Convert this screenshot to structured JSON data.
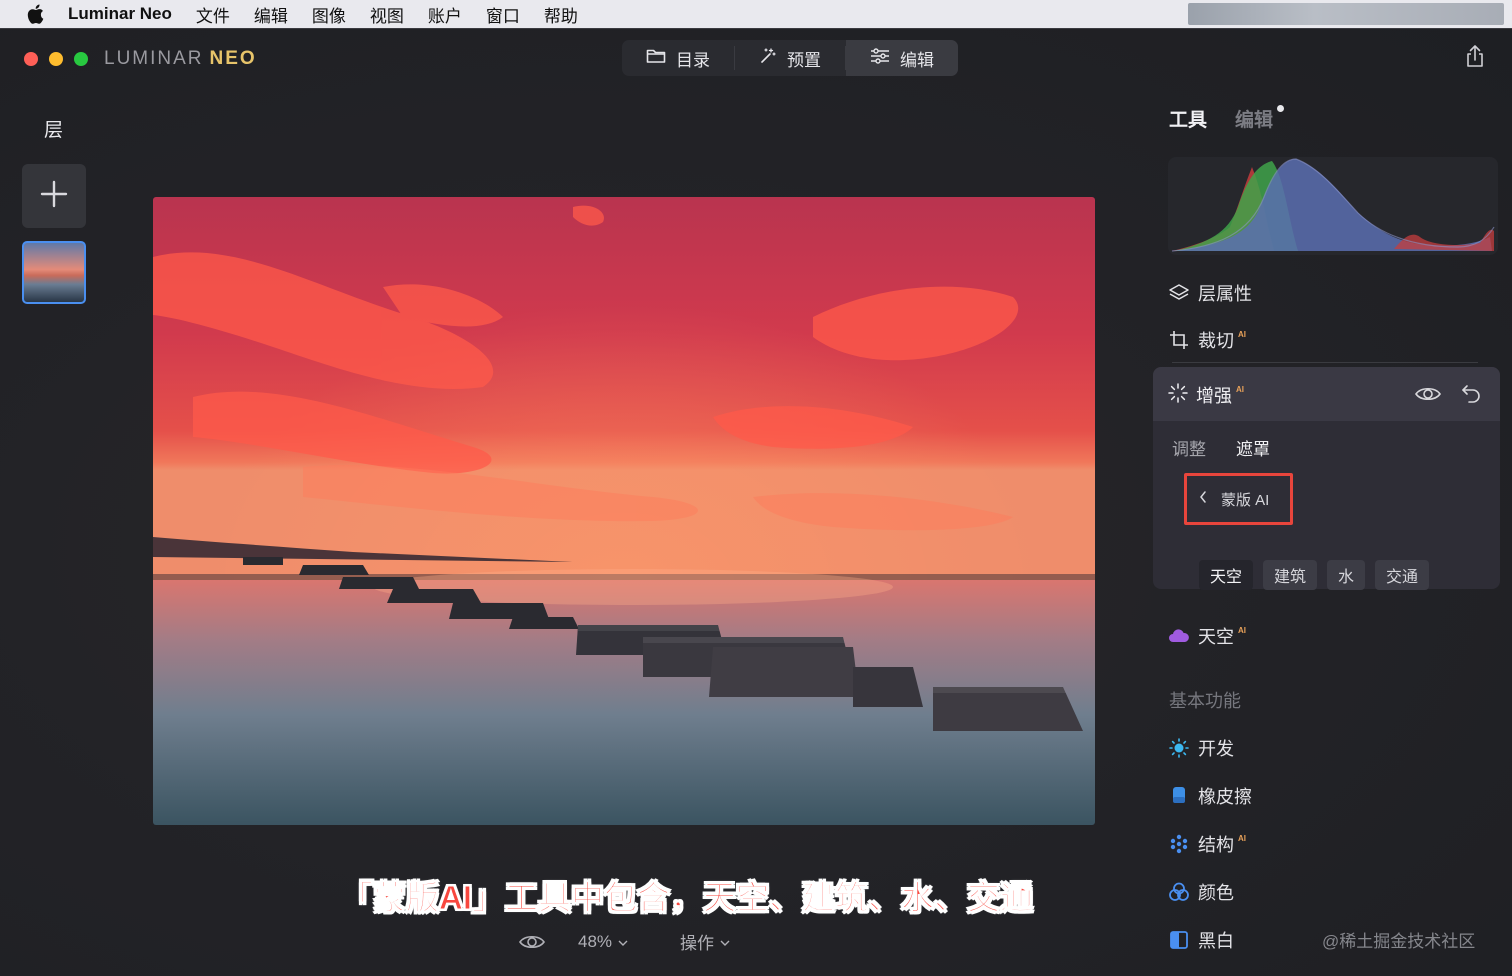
{
  "menubar": {
    "app_name": "Luminar Neo",
    "items": [
      "文件",
      "编辑",
      "图像",
      "视图",
      "账户",
      "窗口",
      "帮助"
    ]
  },
  "titlebar": {
    "brand_left": "LUMINAR",
    "brand_right": "NEO",
    "tabs": [
      {
        "label": "目录",
        "icon": "folder-icon"
      },
      {
        "label": "预置",
        "icon": "sparkle-icon"
      },
      {
        "label": "编辑",
        "icon": "sliders-icon",
        "active": true
      }
    ]
  },
  "layers": {
    "title": "层"
  },
  "canvas": {
    "caption": "「蒙版AI」工具中包含，天空、建筑、水、交通",
    "zoom": "48%",
    "ops_label": "操作"
  },
  "panel": {
    "tab_tools": "工具",
    "tab_edit": "编辑",
    "tools": [
      {
        "label": "层属性",
        "icon": "layers-icon"
      },
      {
        "label": "裁切",
        "icon": "crop-icon",
        "ai": "AI"
      }
    ],
    "enhance": {
      "title": "增强",
      "ai": "AI",
      "subtab_adjust": "调整",
      "subtab_mask": "遮罩",
      "mask_ai_label": "蒙版 AI",
      "chips": [
        "天空",
        "建筑",
        "水",
        "交通"
      ],
      "active_chip": "天空"
    },
    "sky": {
      "label": "天空",
      "ai": "AI",
      "icon": "cloud-icon"
    },
    "basic_section": "基本功能",
    "basic_tools": [
      {
        "label": "开发",
        "icon": "sun-icon",
        "ai": ""
      },
      {
        "label": "橡皮擦",
        "icon": "eraser-icon",
        "ai": ""
      },
      {
        "label": "结构",
        "icon": "structure-icon",
        "ai": "AI"
      },
      {
        "label": "颜色",
        "icon": "color-icon",
        "ai": ""
      },
      {
        "label": "黑白",
        "icon": "bw-icon",
        "ai": ""
      }
    ]
  },
  "watermark": "@稀土掘金技术社区",
  "colors": {
    "accent_blue": "#4a8ff0",
    "highlight_red": "#e8453c",
    "ai_orange": "#e9a25a"
  }
}
